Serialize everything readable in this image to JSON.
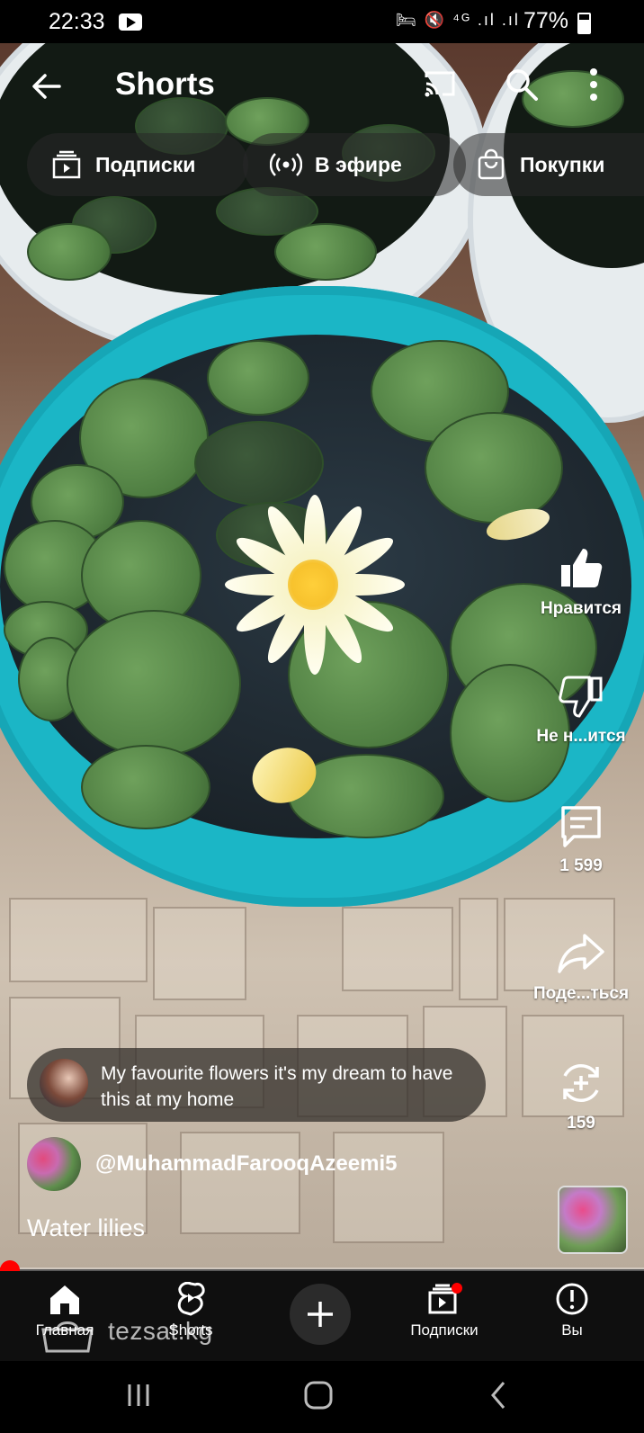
{
  "status_bar": {
    "time": "22:33",
    "icons": "🛏 🔇 ⁴ᴳ .ıl .ıl",
    "battery": "77%"
  },
  "header": {
    "title": "Shorts"
  },
  "chips": [
    {
      "label": "Подписки",
      "icon": "subscriptions-icon"
    },
    {
      "label": "В эфире",
      "icon": "live-icon"
    },
    {
      "label": "Покупки",
      "icon": "shopping-bag-icon"
    }
  ],
  "actions": {
    "like_label": "Нравится",
    "dislike_label": "Не н...ится",
    "comments_count": "1 599",
    "share_label": "Поде...ться",
    "remix_count": "159"
  },
  "comment": {
    "text": "My favourite flowers it's my dream to have this at my home"
  },
  "author": {
    "handle": "@MuhammadFarooqAzeemi5"
  },
  "video": {
    "title": "Water lilies",
    "progress": 0.01
  },
  "bottom_nav": {
    "items": [
      {
        "label": "Главная",
        "icon": "home-icon"
      },
      {
        "label": "Shorts",
        "icon": "shorts-icon"
      },
      {
        "label": "",
        "icon": "create-icon"
      },
      {
        "label": "Подписки",
        "icon": "subscriptions-icon"
      },
      {
        "label": "Вы",
        "icon": "you-icon"
      }
    ]
  },
  "watermark": {
    "text": "tezsat.kg"
  },
  "colors": {
    "accent": "#ff0000",
    "tub": "#1bb6c6"
  }
}
